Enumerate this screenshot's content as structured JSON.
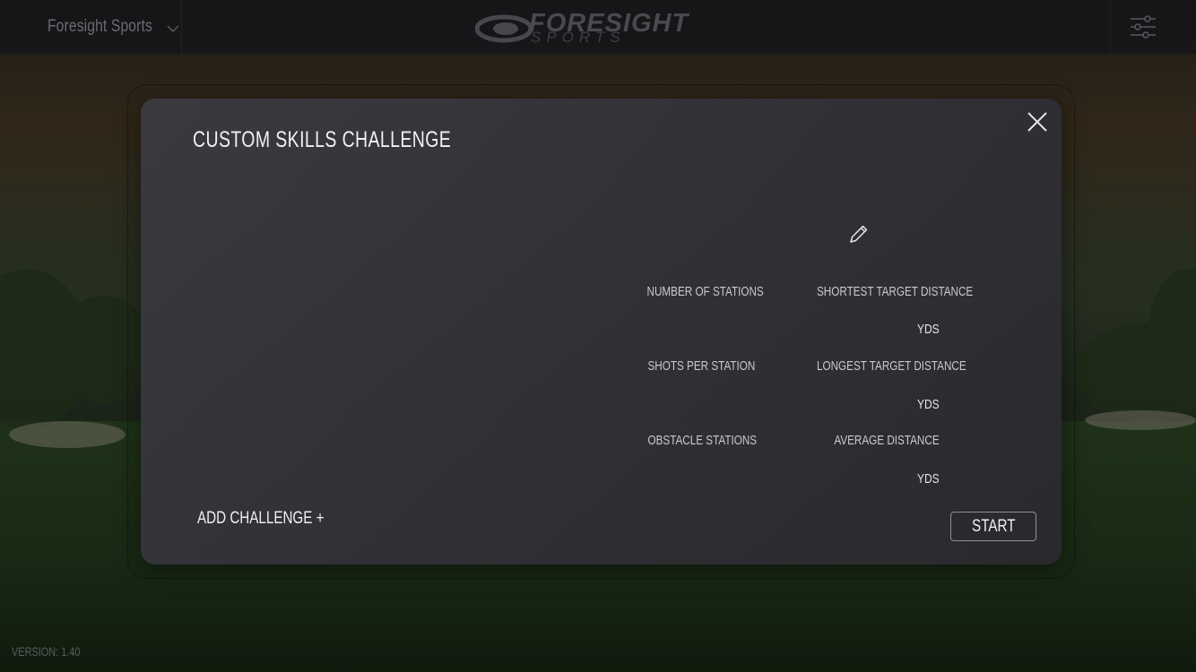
{
  "topbar": {
    "account_label": "Foresight Sports",
    "logo_primary": "FORESIGHT",
    "logo_secondary": "SPORTS"
  },
  "modal": {
    "title": "CUSTOM SKILLS CHALLENGE",
    "fields": {
      "number_of_stations": "NUMBER OF STATIONS",
      "shortest_target_distance": "SHORTEST TARGET DISTANCE",
      "shots_per_station": "SHOTS PER STATION",
      "longest_target_distance": "LONGEST TARGET DISTANCE",
      "obstacle_stations": "OBSTACLE STATIONS",
      "average_distance": "AVERAGE DISTANCE"
    },
    "unit_yds": "YDS",
    "add_challenge_label": "ADD CHALLENGE +",
    "start_label": "START"
  },
  "footer": {
    "version": "VERSION: 1.40"
  },
  "icons": {
    "account_dropdown": "chevron-down-icon",
    "settings": "sliders-icon",
    "close": "close-icon",
    "edit": "pencil-icon"
  },
  "colors": {
    "modal_bg": "#3a3a40",
    "text_primary": "#f1f1f3",
    "text_muted": "#6c6c70",
    "button_border": "#8f8f94"
  }
}
